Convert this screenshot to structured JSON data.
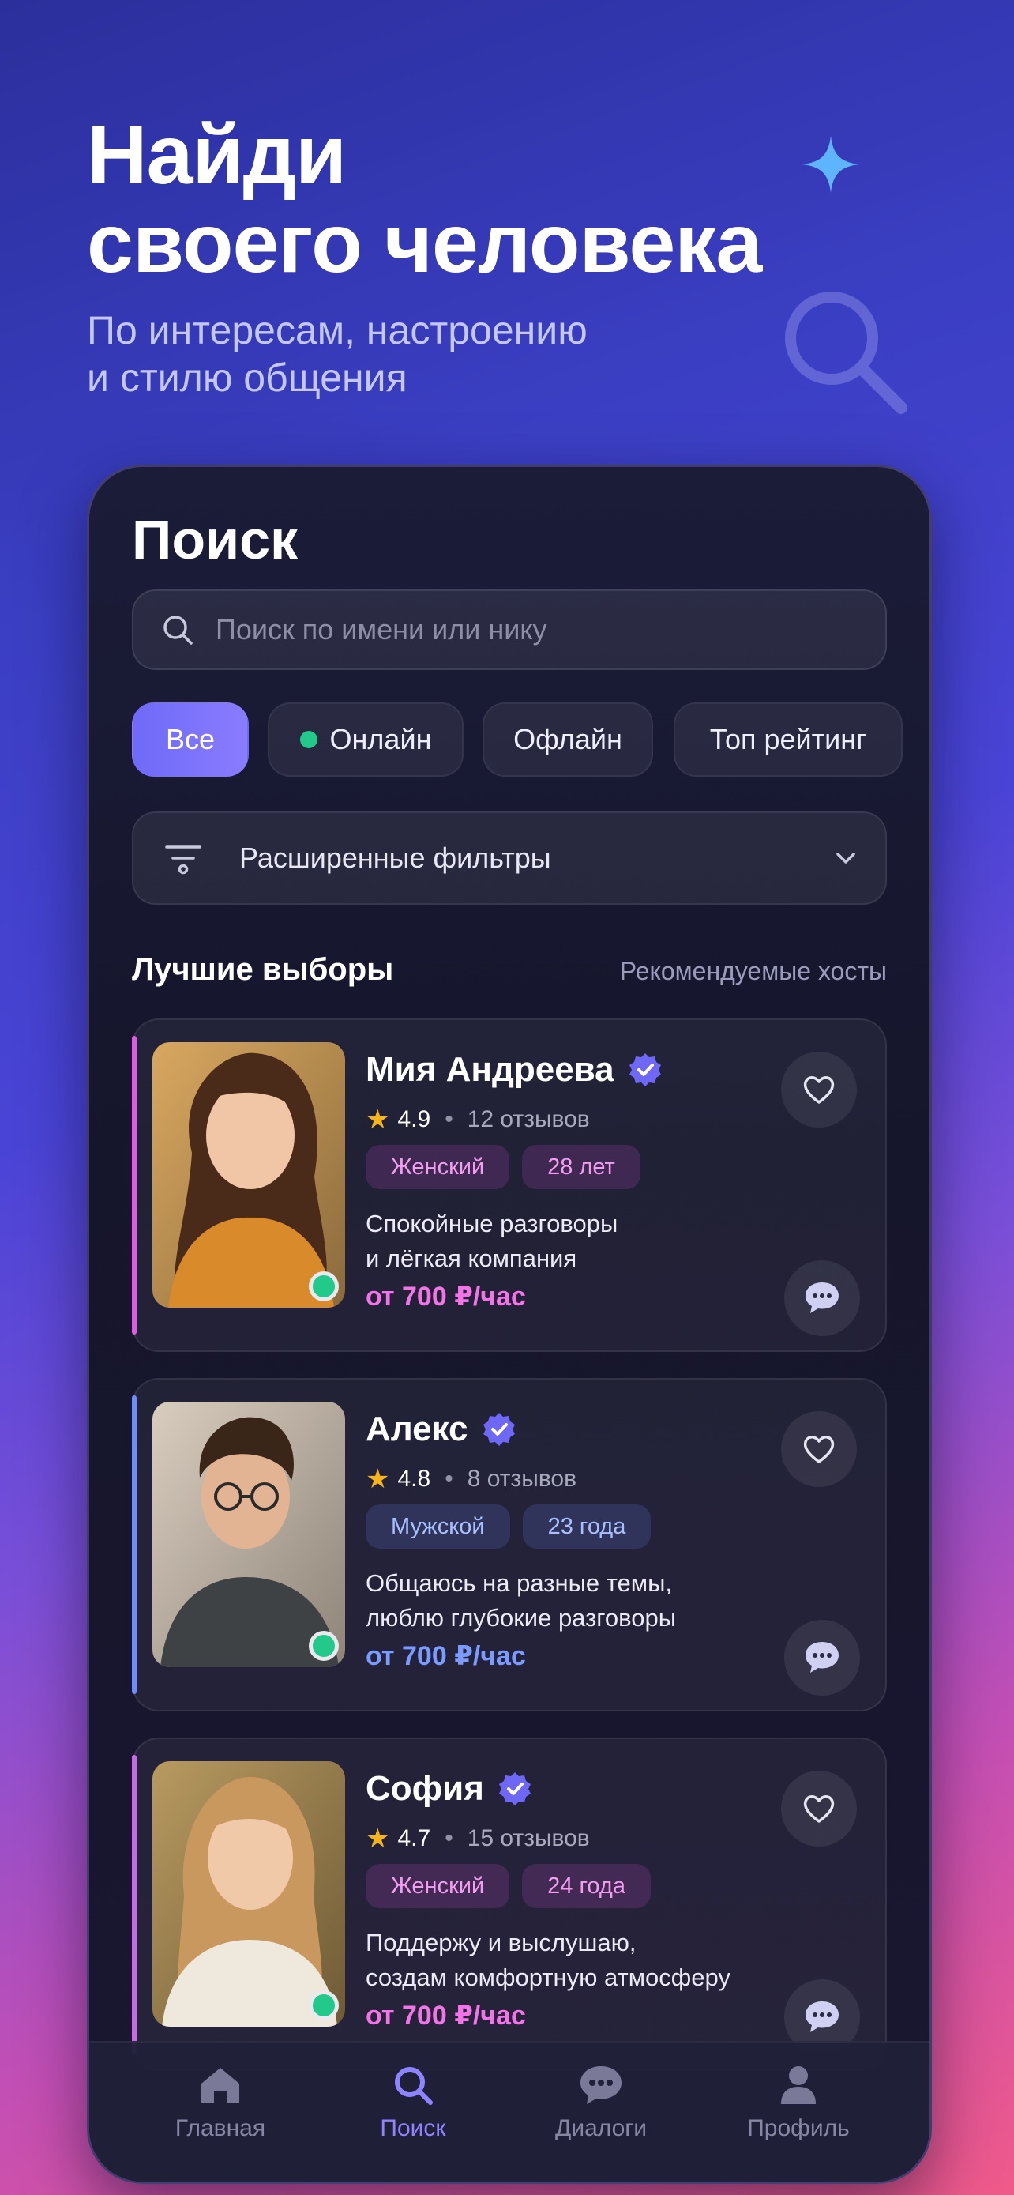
{
  "hero": {
    "title_line1": "Найди",
    "title_line2": "своего человека",
    "subtitle_line1": "По интересам, настроению",
    "subtitle_line2": "и стилю общения"
  },
  "screen": {
    "title": "Поиск",
    "search_placeholder": "Поиск по имени или нику",
    "chips": [
      "Все",
      "Онлайн",
      "Офлайн",
      "Топ рейтинг"
    ],
    "active_chip": "Все",
    "filters_label": "Расширенные фильтры",
    "section_title": "Лучшие выборы",
    "section_link": "Рекомендуемые хосты"
  },
  "hosts": [
    {
      "name": "Мия Андреева",
      "rating": "4.9",
      "reviews": "12 отзывов",
      "gender": "Женский",
      "age": "28 лет",
      "desc_line1": "Спокойные разговоры",
      "desc_line2": "и лёгкая компания",
      "price": "от 700 ₽/час",
      "accent": "#e05ae6",
      "online": true
    },
    {
      "name": "Алекс",
      "rating": "4.8",
      "reviews": "8 отзывов",
      "gender": "Мужской",
      "age": "23 года",
      "desc_line1": "Общаюсь на разные темы,",
      "desc_line2": "люблю глубокие разговоры",
      "price": "от 700 ₽/час",
      "accent": "#6c8cff",
      "online": true
    },
    {
      "name": "София",
      "rating": "4.7",
      "reviews": "15 отзывов",
      "gender": "Женский",
      "age": "24 года",
      "desc_line1": "Поддержу и выслушаю,",
      "desc_line2": "создам комфортную атмосферу",
      "price": "от 700 ₽/час",
      "accent": "#c86ae8",
      "online": true
    }
  ],
  "tabbar": [
    {
      "label": "Главная",
      "icon": "home-icon"
    },
    {
      "label": "Поиск",
      "icon": "search-icon"
    },
    {
      "label": "Диалоги",
      "icon": "chat-icon"
    },
    {
      "label": "Профиль",
      "icon": "user-icon"
    }
  ],
  "active_tab": "Поиск",
  "colors": {
    "accent": "#7b72ff",
    "online": "#22c98a",
    "pink_price": "#f275e8",
    "blue_price": "#7c9bff",
    "star": "#f5b51b"
  }
}
